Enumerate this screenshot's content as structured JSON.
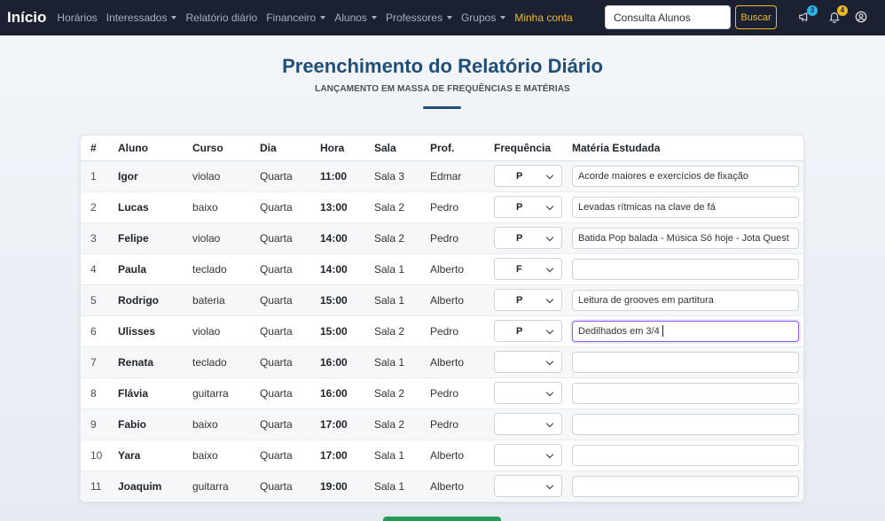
{
  "navbar": {
    "brand": "Início",
    "items": [
      {
        "label": "Horários",
        "dropdown": false
      },
      {
        "label": "Interessados",
        "dropdown": true
      },
      {
        "label": "Relatório diário",
        "dropdown": false
      },
      {
        "label": "Financeiro",
        "dropdown": true
      },
      {
        "label": "Alunos",
        "dropdown": true
      },
      {
        "label": "Professores",
        "dropdown": true
      },
      {
        "label": "Grupos",
        "dropdown": true
      },
      {
        "label": "Minha conta",
        "dropdown": false
      }
    ],
    "search_placeholder": "Consulta Alunos",
    "search_button": "Buscar",
    "announcements_badge": "3",
    "notifications_badge": "4"
  },
  "header": {
    "title": "Preenchimento do Relatório Diário",
    "subtitle": "LANÇAMENTO EM MASSA DE FREQUÊNCIAS E MATÉRIAS"
  },
  "table": {
    "columns": [
      "#",
      "Aluno",
      "Curso",
      "Dia",
      "Hora",
      "Sala",
      "Prof.",
      "Frequência",
      "Matéria Estudada"
    ],
    "rows": [
      {
        "num": "1",
        "aluno": "Igor",
        "curso": "violao",
        "dia": "Quarta",
        "hora": "11:00",
        "sala": "Sala 3",
        "prof": "Edmar",
        "freq": "P",
        "materia": "Acorde maiores e exercícios de fixação"
      },
      {
        "num": "2",
        "aluno": "Lucas",
        "curso": "baixo",
        "dia": "Quarta",
        "hora": "13:00",
        "sala": "Sala 2",
        "prof": "Pedro",
        "freq": "P",
        "materia": "Levadas rítmicas na clave de fá"
      },
      {
        "num": "3",
        "aluno": "Felipe",
        "curso": "violao",
        "dia": "Quarta",
        "hora": "14:00",
        "sala": "Sala 2",
        "prof": "Pedro",
        "freq": "P",
        "materia": "Batida Pop balada - Música Só hoje - Jota Quest"
      },
      {
        "num": "4",
        "aluno": "Paula",
        "curso": "teclado",
        "dia": "Quarta",
        "hora": "14:00",
        "sala": "Sala 1",
        "prof": "Alberto",
        "freq": "F",
        "materia": ""
      },
      {
        "num": "5",
        "aluno": "Rodrigo",
        "curso": "bateria",
        "dia": "Quarta",
        "hora": "15:00",
        "sala": "Sala 1",
        "prof": "Alberto",
        "freq": "P",
        "materia": "Leitura de grooves em partitura"
      },
      {
        "num": "6",
        "aluno": "Ulisses",
        "curso": "violao",
        "dia": "Quarta",
        "hora": "15:00",
        "sala": "Sala 2",
        "prof": "Pedro",
        "freq": "P",
        "materia": "Dedilhados em 3/4"
      },
      {
        "num": "7",
        "aluno": "Renata",
        "curso": "teclado",
        "dia": "Quarta",
        "hora": "16:00",
        "sala": "Sala 1",
        "prof": "Alberto",
        "freq": "",
        "materia": ""
      },
      {
        "num": "8",
        "aluno": "Flávia",
        "curso": "guitarra",
        "dia": "Quarta",
        "hora": "16:00",
        "sala": "Sala 2",
        "prof": "Pedro",
        "freq": "",
        "materia": ""
      },
      {
        "num": "9",
        "aluno": "Fabio",
        "curso": "baixo",
        "dia": "Quarta",
        "hora": "17:00",
        "sala": "Sala 2",
        "prof": "Pedro",
        "freq": "",
        "materia": ""
      },
      {
        "num": "10",
        "aluno": "Yara",
        "curso": "baixo",
        "dia": "Quarta",
        "hora": "17:00",
        "sala": "Sala 1",
        "prof": "Alberto",
        "freq": "",
        "materia": ""
      },
      {
        "num": "11",
        "aluno": "Joaquim",
        "curso": "guitarra",
        "dia": "Quarta",
        "hora": "19:00",
        "sala": "Sala 1",
        "prof": "Alberto",
        "freq": "",
        "materia": ""
      }
    ],
    "focused_row": 5
  },
  "colors": {
    "navbar_bg": "#1b2130",
    "accent_yellow": "#f1b826",
    "title_blue": "#1f4e79",
    "focus_purple": "#8a5cf6",
    "save_green": "#1f9d55"
  }
}
